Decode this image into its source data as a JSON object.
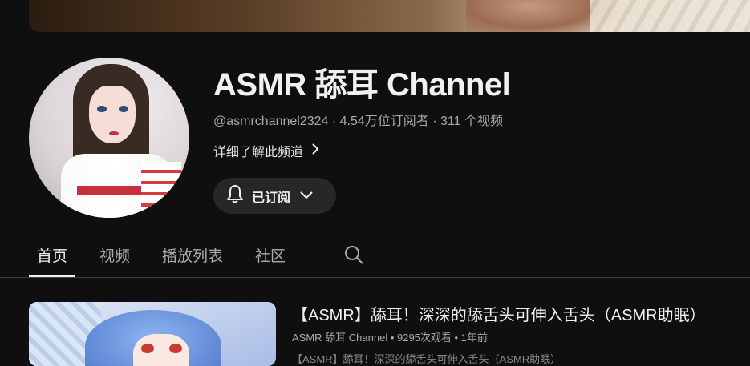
{
  "channel": {
    "name": "ASMR 舔耳 Channel",
    "meta": "@asmrchannel2324 · 4.54万位订阅者 · 311 个视频",
    "about_label": "详细了解此频道",
    "subscribe_label": "已订阅"
  },
  "tabs": [
    {
      "label": "首页",
      "active": true
    },
    {
      "label": "视频",
      "active": false
    },
    {
      "label": "播放列表",
      "active": false
    },
    {
      "label": "社区",
      "active": false
    }
  ],
  "video": {
    "title": "【ASMR】舔耳！深深的舔舌头可伸入舌头（ASMR助眠）",
    "meta": "ASMR 舔耳 Channel • 9295次观看 • 1年前",
    "description": "【ASMR】舔耳！深深的舔舌头可伸入舌头（ASMR助眠）"
  },
  "icons": {
    "bell": "bell-icon",
    "chevron_right": "chevron-right-icon",
    "chevron_down": "chevron-down-icon",
    "search": "search-icon"
  },
  "colors": {
    "background": "#0f0f0f",
    "text": "#f1f1f1",
    "secondary_text": "#aaaaaa",
    "button_bg": "#272727"
  }
}
